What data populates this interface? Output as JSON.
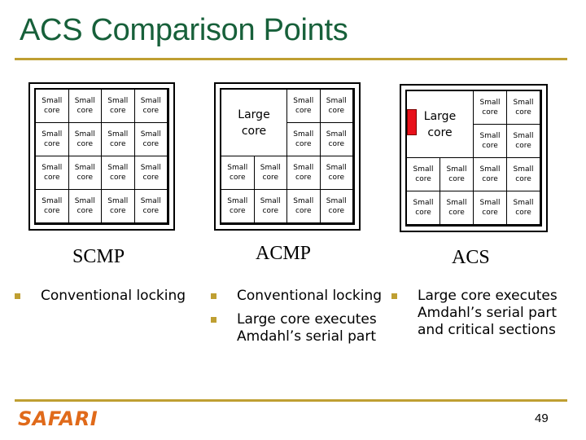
{
  "slide": {
    "title": "ACS Comparison Points",
    "page_number": "49",
    "logo_text": "SAFARI",
    "colors": {
      "title": "#17603a",
      "rule": "#bf9f32",
      "bullet": "#bf9f32",
      "accelerator": "#e8101a",
      "logo": "#e06a1a"
    }
  },
  "cell_text": {
    "small_line1": "Small",
    "small_line2": "core",
    "large_line1": "Large",
    "large_line2": "core"
  },
  "columns": [
    {
      "label": "SCMP",
      "layout": "16 small cores",
      "bullets": [
        "Conventional locking"
      ]
    },
    {
      "label": "ACMP",
      "layout": "1 large core + 12 small cores",
      "bullets": [
        "Conventional locking",
        "Large core executes Amdahl’s serial part"
      ]
    },
    {
      "label": "ACS",
      "layout": "1 large core with accelerator + 12 small cores",
      "bullets": [
        "Large core executes Amdahl’s serial part and critical sections"
      ]
    }
  ]
}
